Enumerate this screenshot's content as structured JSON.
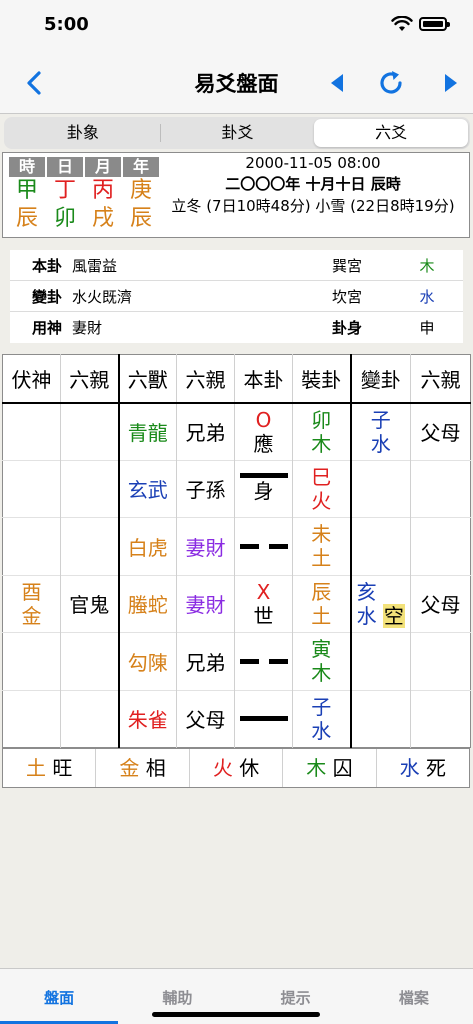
{
  "status": {
    "time": "5:00"
  },
  "nav": {
    "title": "易爻盤面"
  },
  "segments": [
    "卦象",
    "卦爻",
    "六爻"
  ],
  "pillars": [
    {
      "head": "時",
      "stem": "甲",
      "stem_color": "#1a8a1a",
      "branch": "辰",
      "branch_color": "#d6811a"
    },
    {
      "head": "日",
      "stem": "丁",
      "stem_color": "#e02020",
      "branch": "卯",
      "branch_color": "#1a8a1a"
    },
    {
      "head": "月",
      "stem": "丙",
      "stem_color": "#e02020",
      "branch": "戌",
      "branch_color": "#d6811a"
    },
    {
      "head": "年",
      "stem": "庚",
      "stem_color": "#d6811a",
      "branch": "辰",
      "branch_color": "#d6811a"
    }
  ],
  "date": {
    "gregorian": "2000-11-05 08:00",
    "lunar": "二〇〇〇年 十月十日 辰時",
    "solar_terms": "立冬 (7日10時48分) 小雪 (22日8時19分)"
  },
  "gua_info": [
    {
      "key": "本卦",
      "value": "風雷益",
      "palace": "巽宮",
      "element": "木",
      "element_color": "#1a8a1a"
    },
    {
      "key": "變卦",
      "value": "水火既濟",
      "palace": "坎宮",
      "element": "水",
      "element_color": "#1a3fb5"
    },
    {
      "key": "用神",
      "value": "妻財",
      "palace": "卦身",
      "element": "申",
      "element_color": "#000000"
    }
  ],
  "table": {
    "headers": [
      "伏神",
      "六親",
      "六獸",
      "六親",
      "本卦",
      "裝卦",
      "變卦",
      "六親"
    ],
    "rows": [
      {
        "fushen": [
          "",
          ""
        ],
        "fushen_color": "#000",
        "fu_liuqin": "",
        "beast": "青龍",
        "beast_color": "#1a8a1a",
        "liuqin": "兄弟",
        "liuqin_color": "#000",
        "yao": "moving-yang",
        "mark": "O",
        "label": "應",
        "zhuang": [
          "卯",
          "木"
        ],
        "zhuang_color": "#1a8a1a",
        "bian": [
          "子",
          "水"
        ],
        "bian_color": "#1a3fb5",
        "bian_void": "",
        "bian_liuqin": "父母"
      },
      {
        "fushen": [
          "",
          ""
        ],
        "fushen_color": "#000",
        "fu_liuqin": "",
        "beast": "玄武",
        "beast_color": "#1a3fb5",
        "liuqin": "子孫",
        "liuqin_color": "#000",
        "yao": "yang",
        "mark": "",
        "label": "身",
        "zhuang": [
          "巳",
          "火"
        ],
        "zhuang_color": "#e02020",
        "bian": [
          "",
          ""
        ],
        "bian_color": "#000",
        "bian_void": "",
        "bian_liuqin": ""
      },
      {
        "fushen": [
          "",
          ""
        ],
        "fushen_color": "#000",
        "fu_liuqin": "",
        "beast": "白虎",
        "beast_color": "#d6811a",
        "liuqin": "妻財",
        "liuqin_color": "#8a2be2",
        "yao": "yin",
        "mark": "",
        "label": "",
        "zhuang": [
          "未",
          "土"
        ],
        "zhuang_color": "#d6811a",
        "bian": [
          "",
          ""
        ],
        "bian_color": "#000",
        "bian_void": "",
        "bian_liuqin": ""
      },
      {
        "fushen": [
          "酉",
          "金"
        ],
        "fushen_color": "#d6811a",
        "fu_liuqin": "官鬼",
        "beast": "螣蛇",
        "beast_color": "#d6811a",
        "liuqin": "妻財",
        "liuqin_color": "#8a2be2",
        "yao": "moving-yin",
        "mark": "X",
        "label": "世",
        "zhuang": [
          "辰",
          "土"
        ],
        "zhuang_color": "#d6811a",
        "bian": [
          "亥",
          "水"
        ],
        "bian_color": "#1a3fb5",
        "bian_void": "空",
        "bian_liuqin": "父母"
      },
      {
        "fushen": [
          "",
          ""
        ],
        "fushen_color": "#000",
        "fu_liuqin": "",
        "beast": "勾陳",
        "beast_color": "#d6811a",
        "liuqin": "兄弟",
        "liuqin_color": "#000",
        "yao": "yin",
        "mark": "",
        "label": "",
        "zhuang": [
          "寅",
          "木"
        ],
        "zhuang_color": "#1a8a1a",
        "bian": [
          "",
          ""
        ],
        "bian_color": "#000",
        "bian_void": "",
        "bian_liuqin": ""
      },
      {
        "fushen": [
          "",
          ""
        ],
        "fushen_color": "#000",
        "fu_liuqin": "",
        "beast": "朱雀",
        "beast_color": "#e02020",
        "liuqin": "父母",
        "liuqin_color": "#000",
        "yao": "yang",
        "mark": "",
        "label": "",
        "zhuang": [
          "子",
          "水"
        ],
        "zhuang_color": "#1a3fb5",
        "bian": [
          "",
          ""
        ],
        "bian_color": "#000",
        "bian_void": "",
        "bian_liuqin": ""
      }
    ]
  },
  "states": [
    {
      "element": "土",
      "element_color": "#d6811a",
      "state": "旺"
    },
    {
      "element": "金",
      "element_color": "#d6811a",
      "state": "相"
    },
    {
      "element": "火",
      "element_color": "#e02020",
      "state": "休"
    },
    {
      "element": "木",
      "element_color": "#1a8a1a",
      "state": "囚"
    },
    {
      "element": "水",
      "element_color": "#1a3fb5",
      "state": "死"
    }
  ],
  "tabs": [
    "盤面",
    "輔助",
    "提示",
    "檔案"
  ],
  "colors": {
    "accent": "#1273e0",
    "pillar_head": "#8a8a8a",
    "void_highlight": "#f3e27a"
  }
}
